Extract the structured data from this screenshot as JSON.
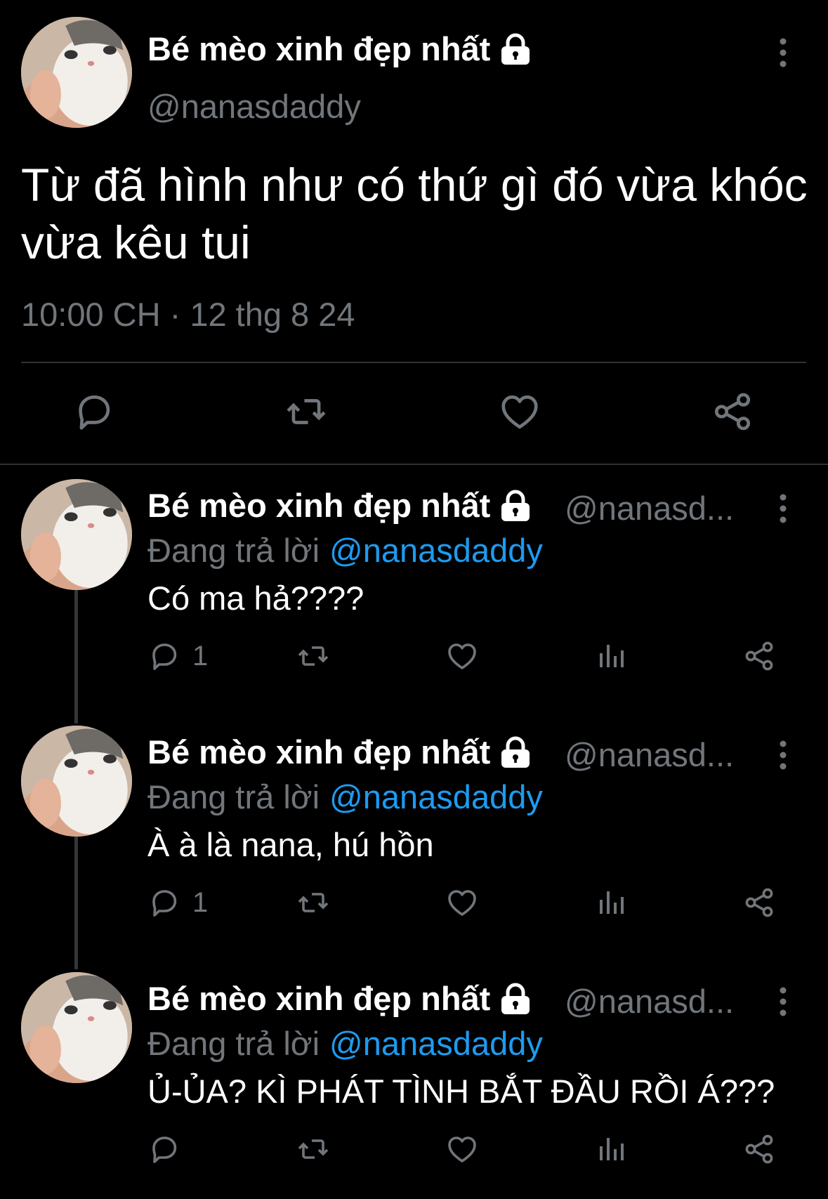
{
  "main_tweet": {
    "display_name": "Bé mèo xinh đẹp nhất",
    "handle": "@nanasdaddy",
    "text": "Từ đã hình như có thứ gì đó vừa khóc vừa kêu tui",
    "timestamp": "10:00 CH · 12 thg 8 24",
    "icons": {
      "lock": "lock-icon",
      "more": "more-vertical-icon",
      "reply": "reply-icon",
      "retweet": "retweet-icon",
      "like": "heart-icon",
      "share": "share-icon"
    }
  },
  "replies": [
    {
      "display_name": "Bé mèo xinh đẹp nhất",
      "handle": "@nanasd...",
      "replying_label": "Đang trả lời",
      "replying_to": "@nanasdaddy",
      "text": "Có ma hả????",
      "reply_count": "1"
    },
    {
      "display_name": "Bé mèo xinh đẹp nhất",
      "handle": "@nanasd...",
      "replying_label": "Đang trả lời",
      "replying_to": "@nanasdaddy",
      "text": "À à là nana, hú hồn",
      "reply_count": "1"
    },
    {
      "display_name": "Bé mèo xinh đẹp nhất",
      "handle": "@nanasd...",
      "replying_label": "Đang trả lời",
      "replying_to": "@nanasdaddy",
      "text": "Ủ-ỦA? KÌ PHÁT TÌNH BẮT ĐẦU RỒI Á???",
      "reply_count": ""
    }
  ],
  "colors": {
    "background": "#000000",
    "text_primary": "#ffffff",
    "text_secondary": "#71767b",
    "accent_link": "#1d9bf0",
    "divider": "#2f3336"
  }
}
